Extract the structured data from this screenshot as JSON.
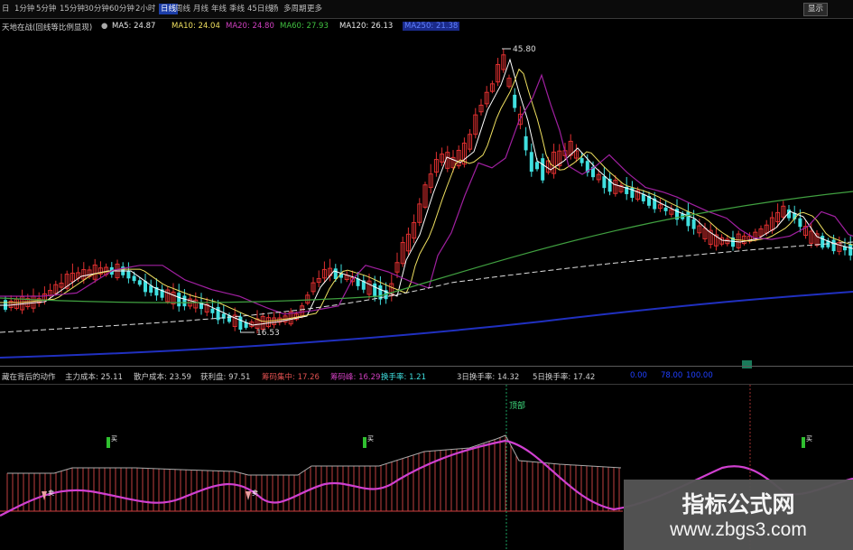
{
  "toolbar": {
    "items": [
      "日",
      "1分钟",
      "5分钟",
      "15分钟",
      "30分钟",
      "60分钟",
      "2小时",
      "日线",
      "周线",
      "月线",
      "年线",
      "季线",
      "45日线",
      "扬",
      "多周期",
      "更多"
    ],
    "active_index": 7,
    "right_button": "显示"
  },
  "ma_row": {
    "indicator": "天地在战(回线等比例显现)",
    "ma": [
      {
        "text": "MA5: 24.87",
        "color": "#e8e8e8"
      },
      {
        "text": "MA10: 24.04",
        "color": "#f0e060"
      },
      {
        "text": "MA20: 24.80",
        "color": "#d040c0"
      },
      {
        "text": "MA60: 27.93",
        "color": "#40c040"
      },
      {
        "text": "MA120: 26.13",
        "color": "#e8e8e8"
      },
      {
        "text": "MA250: 21.38",
        "color": "#2040ff"
      }
    ]
  },
  "main_chart": {
    "high_label": "45.80",
    "low_label": "16.53",
    "colors": {
      "up": "#e03030",
      "down": "#40e0e0",
      "ma5": "#ffffff",
      "ma10": "#f0e060",
      "ma20": "#a020a0",
      "ma60": "#40a040",
      "ma120": "#e0e0e0",
      "ma250": "#2030c0"
    }
  },
  "indicator_row": {
    "items": [
      {
        "text": "藏在背后的动作",
        "color": "#cfcfcf"
      },
      {
        "text": "主力成本: 25.11",
        "color": "#cfcfcf"
      },
      {
        "text": "散户成本: 23.59",
        "color": "#cfcfcf"
      },
      {
        "text": "获利盘: 97.51",
        "color": "#cfcfcf"
      },
      {
        "text": "筹码集中: 17.26",
        "color": "#e05050"
      },
      {
        "text": "筹码峰: 16.29",
        "color": "#d040c0"
      },
      {
        "text": "换手率: 1.21",
        "color": "#40e0e0"
      },
      {
        "text": "3日换手率: 14.32",
        "color": "#cfcfcf"
      },
      {
        "text": "5日换手率: 17.42",
        "color": "#cfcfcf"
      },
      {
        "text": "0.00",
        "color": "#2040ff"
      },
      {
        "text": "78.00",
        "color": "#2040ff"
      },
      {
        "text": "100.00",
        "color": "#2040ff"
      }
    ]
  },
  "sub_chart": {
    "top_label": "顶部",
    "buy_labels": [
      "买",
      "买",
      "买",
      "买"
    ],
    "sell_labels": [
      "卖",
      "卖"
    ]
  },
  "watermark": {
    "title": "指标公式网",
    "url": "www.zbgs3.com"
  }
}
